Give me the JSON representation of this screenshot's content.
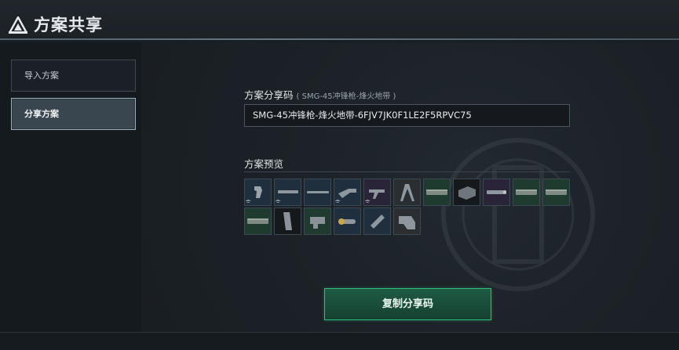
{
  "header": {
    "title": "方案共享",
    "logo_icon": "triangle-logo-icon"
  },
  "sidebar": {
    "items": [
      {
        "label": "导入方案",
        "active": false
      },
      {
        "label": "分享方案",
        "active": true
      }
    ]
  },
  "share": {
    "code_label": "方案分享码",
    "code_sub": "( SMG-45冲锋枪-烽火地带 )",
    "code_value": "SMG-45冲锋枪-烽火地带-6FJV7JK0F1LE2F5RPVC75",
    "preview_label": "方案预览",
    "copy_button": "复制分享码"
  },
  "preview_items": [
    {
      "icon": "grip-icon",
      "tint": "blue",
      "mod": "⌯"
    },
    {
      "icon": "barrel-icon",
      "tint": "blue",
      "mod": "⌯"
    },
    {
      "icon": "long-barrel-icon",
      "tint": "blue",
      "mod": ""
    },
    {
      "icon": "stock-icon",
      "tint": "blue",
      "mod": "⌯"
    },
    {
      "icon": "foregrip-icon",
      "tint": "purple",
      "mod": "⌯"
    },
    {
      "icon": "bipod-icon",
      "tint": "gray",
      "mod": ""
    },
    {
      "icon": "rail-icon",
      "tint": "green",
      "mod": ""
    },
    {
      "icon": "box-icon",
      "tint": "dark",
      "mod": ""
    },
    {
      "icon": "laser-icon",
      "tint": "purple",
      "mod": ""
    },
    {
      "icon": "rail-icon",
      "tint": "green",
      "mod": ""
    },
    {
      "icon": "rail-icon",
      "tint": "green",
      "mod": ""
    },
    {
      "icon": "rail-icon",
      "tint": "green",
      "mod": ""
    },
    {
      "icon": "magazine-icon",
      "tint": "dark",
      "mod": ""
    },
    {
      "icon": "cover-icon",
      "tint": "green",
      "mod": ""
    },
    {
      "icon": "scope-icon",
      "tint": "blue",
      "mod": ""
    },
    {
      "icon": "adapter-icon",
      "tint": "blue",
      "mod": ""
    },
    {
      "icon": "buttstock-icon",
      "tint": "gray",
      "mod": ""
    }
  ],
  "colors": {
    "accent": "#2fbf7d",
    "panel": "#1b2126",
    "border": "#3c4852"
  }
}
